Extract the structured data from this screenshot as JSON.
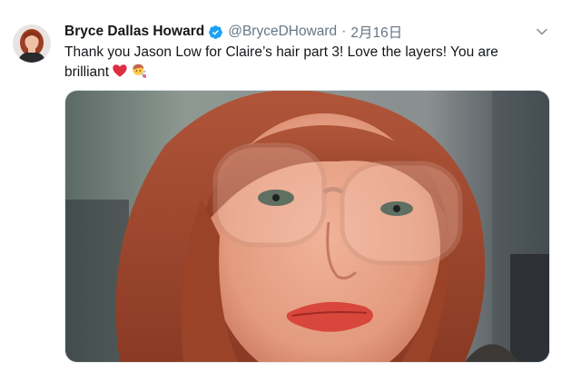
{
  "tweet": {
    "author": {
      "display_name": "Bryce Dallas Howard",
      "handle": "@BryceDHoward",
      "verified": true,
      "avatar_icon": "profile-photo-avatar"
    },
    "separator": "·",
    "date": "2月16日",
    "text": "Thank you Jason Low for Claire’s hair part 3! Love the layers! You are brilliant",
    "emojis": [
      "red-heart-emoji",
      "haircut-emoji"
    ],
    "menu_icon": "chevron-down-icon",
    "media": {
      "kind": "photo",
      "description_icon": "selfie-photo"
    }
  },
  "colors": {
    "text": "#14171a",
    "secondary": "#657786",
    "verified_blue": "#1da1f2",
    "border": "#e1e8ed"
  }
}
